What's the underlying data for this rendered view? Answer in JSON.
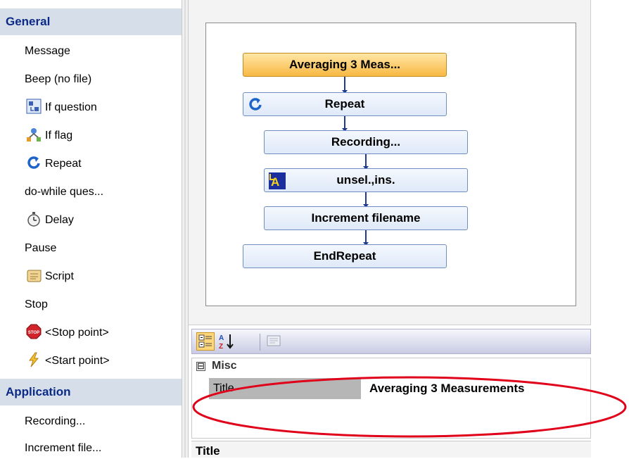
{
  "toolbox": {
    "sections": [
      {
        "title": "General",
        "items": [
          {
            "label": "Message",
            "icon": ""
          },
          {
            "label": "Beep (no file)",
            "icon": ""
          },
          {
            "label": "If question",
            "icon": "if-question-icon"
          },
          {
            "label": "If flag",
            "icon": "if-flag-icon"
          },
          {
            "label": "Repeat",
            "icon": "repeat-icon"
          },
          {
            "label": "do-while ques...",
            "icon": ""
          },
          {
            "label": "Delay",
            "icon": "stopwatch-icon"
          },
          {
            "label": "Pause",
            "icon": ""
          },
          {
            "label": "Script",
            "icon": "script-scroll-icon"
          },
          {
            "label": "Stop",
            "icon": ""
          },
          {
            "label": "<Stop point>",
            "icon": "stop-sign-icon"
          },
          {
            "label": "<Start point>",
            "icon": "lightning-icon"
          }
        ]
      },
      {
        "title": "Application",
        "items": [
          {
            "label": "Recording...",
            "icon": ""
          },
          {
            "label": "Increment file...",
            "icon": ""
          }
        ]
      }
    ]
  },
  "workflow": {
    "steps": [
      {
        "label": "Averaging 3 Meas...",
        "selected": true,
        "icon": ""
      },
      {
        "label": "Repeat",
        "selected": false,
        "icon": "repeat-icon"
      },
      {
        "label": "Recording...",
        "selected": false,
        "icon": ""
      },
      {
        "label": "unsel.,ins.",
        "selected": false,
        "icon": "unsel-ins-icon"
      },
      {
        "label": "Increment filename",
        "selected": false,
        "icon": ""
      },
      {
        "label": "EndRepeat",
        "selected": false,
        "icon": ""
      }
    ]
  },
  "properties": {
    "toolbar": {
      "categorized_icon": "categorized-icon",
      "alphabetical_icon": "sort-az-icon",
      "property_pages_icon": "property-pages-icon"
    },
    "category": {
      "label": "Misc",
      "expander": "⊟"
    },
    "rows": [
      {
        "name": "Title",
        "value": "Averaging 3 Measurements"
      }
    ],
    "description_title": "Title"
  },
  "colors": {
    "section_header_bg": "#d6dfe9",
    "section_header_text": "#0b2a86",
    "selected_step": "#f8b843",
    "annotation": "#e0001a"
  }
}
